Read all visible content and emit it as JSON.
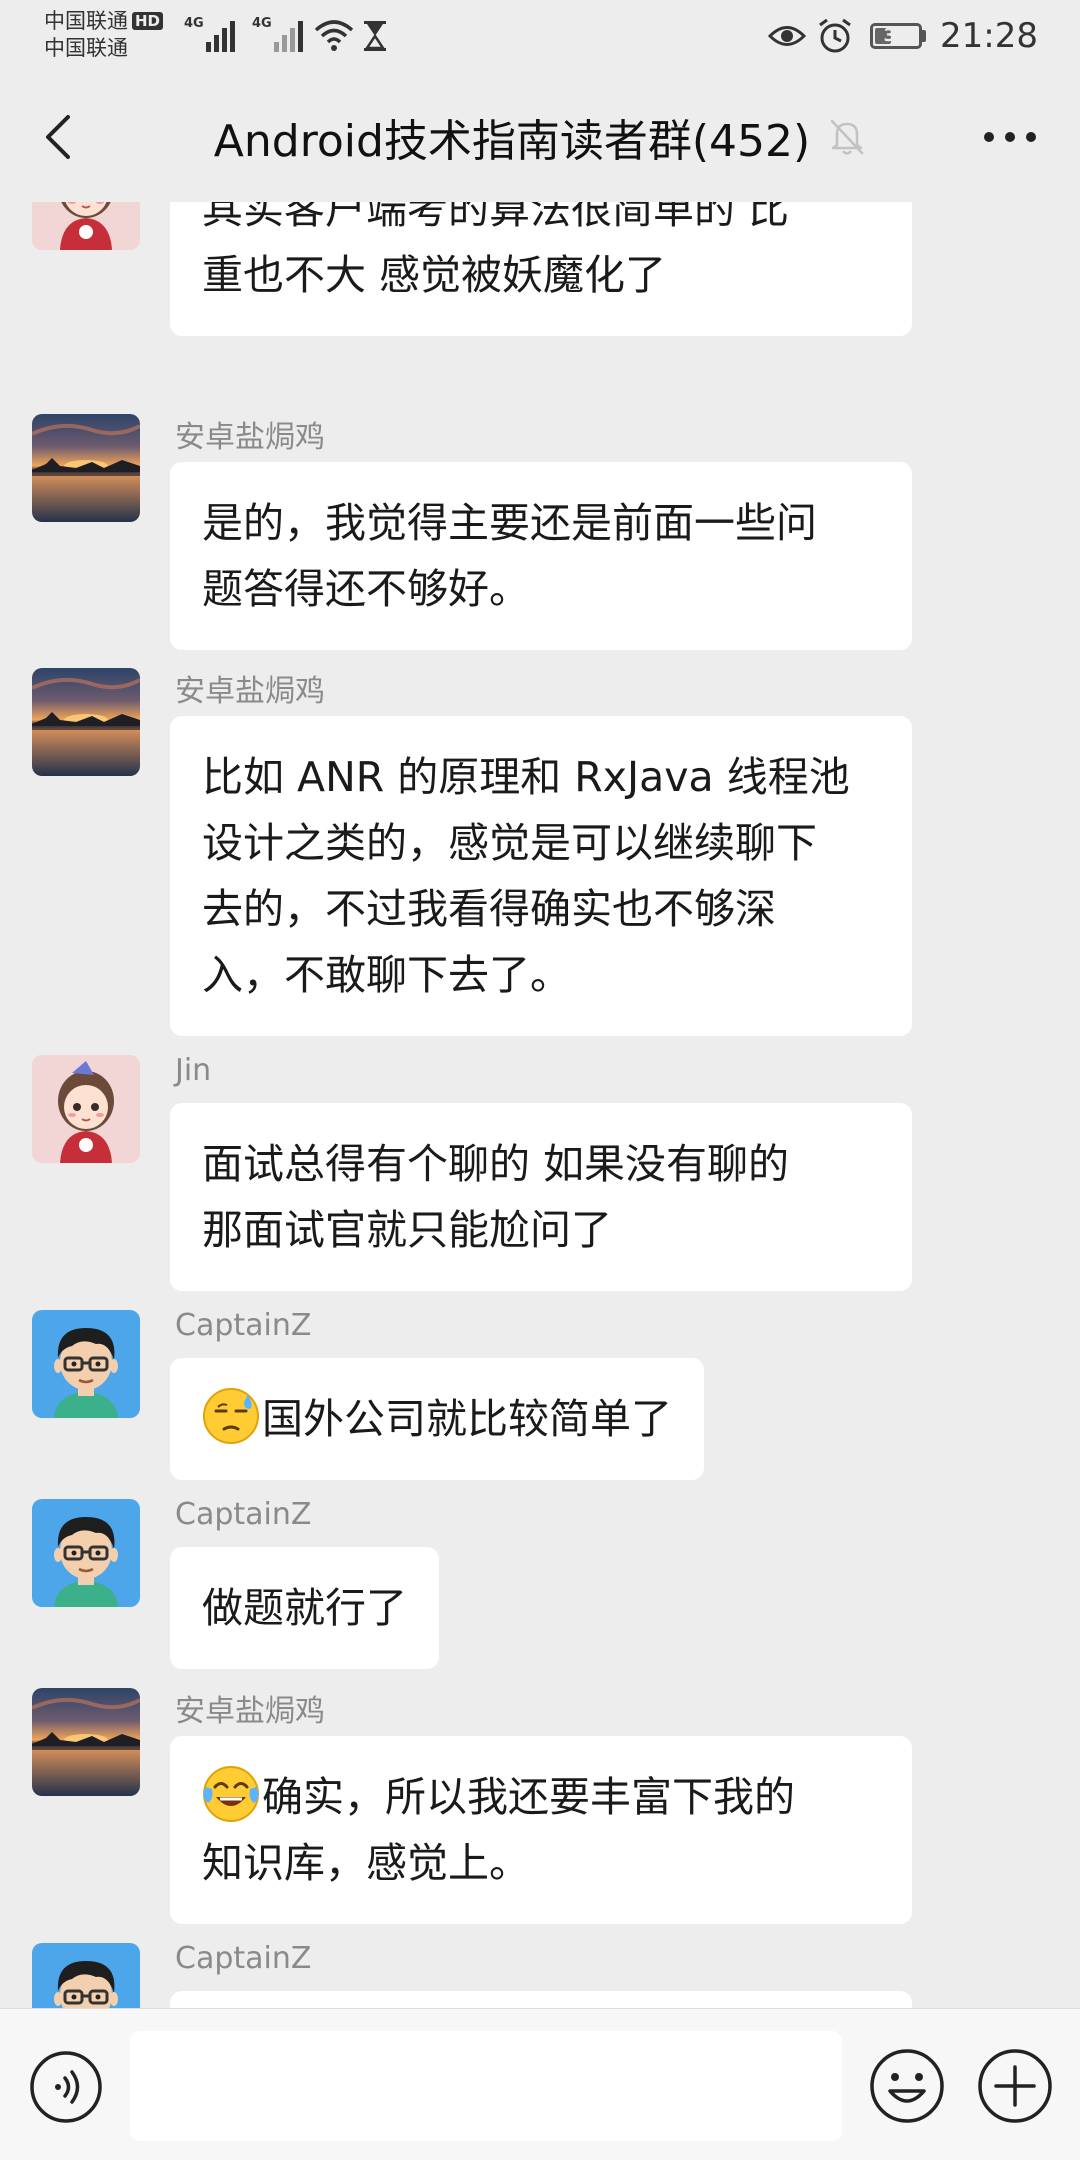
{
  "status_bar": {
    "carrier_1": "中国联通",
    "carrier_2": "中国联通",
    "hd_badge": "HD",
    "network_1": "4G",
    "network_2": "4G",
    "battery_level": 39,
    "battery_text": "39",
    "time": "21:28",
    "icons": [
      "signal-icon",
      "wifi-icon",
      "hourglass-icon",
      "eye-icon",
      "alarm-icon",
      "battery-icon"
    ]
  },
  "header": {
    "title": "Android技术指南读者群(452)",
    "icons": [
      "back-icon",
      "mute-bell-icon",
      "more-icon"
    ]
  },
  "messages": [
    {
      "sender": "",
      "avatar": "anime-girl-avatar",
      "lines": [
        "其实客户端考的算法很简单的  比",
        "重也不大  感觉被妖魔化了"
      ],
      "emoji": ""
    },
    {
      "sender": "安卓盐焗鸡",
      "avatar": "sunset-lake-avatar",
      "lines": [
        "是的，我觉得主要还是前面一些问",
        "题答得还不够好。"
      ],
      "emoji": ""
    },
    {
      "sender": "安卓盐焗鸡",
      "avatar": "sunset-lake-avatar",
      "lines": [
        "比如 ANR 的原理和 RxJava 线程池",
        "设计之类的，感觉是可以继续聊下",
        "去的，不过我看得确实也不够深",
        "入，不敢聊下去了。"
      ],
      "emoji": ""
    },
    {
      "sender": "Jin",
      "avatar": "anime-girl-avatar",
      "lines": [
        "面试总得有个聊的  如果没有聊的",
        "那面试官就只能尬问了"
      ],
      "emoji": ""
    },
    {
      "sender": "CaptainZ",
      "avatar": "glasses-boy-avatar",
      "lines": [
        "国外公司就比较简单了"
      ],
      "emoji": "sweat-emoji"
    },
    {
      "sender": "CaptainZ",
      "avatar": "glasses-boy-avatar",
      "lines": [
        "做题就行了"
      ],
      "emoji": ""
    },
    {
      "sender": "安卓盐焗鸡",
      "avatar": "sunset-lake-avatar",
      "lines": [
        "确实，所以我还要丰富下我的",
        "知识库，感觉上。"
      ],
      "emoji": "tears-of-joy-emoji"
    },
    {
      "sender": "CaptainZ",
      "avatar": "glasses-boy-avatar",
      "lines": [],
      "emoji": ""
    }
  ],
  "input_bar": {
    "placeholder": "",
    "icons": [
      "voice-icon",
      "emoji-icon",
      "add-icon"
    ]
  }
}
